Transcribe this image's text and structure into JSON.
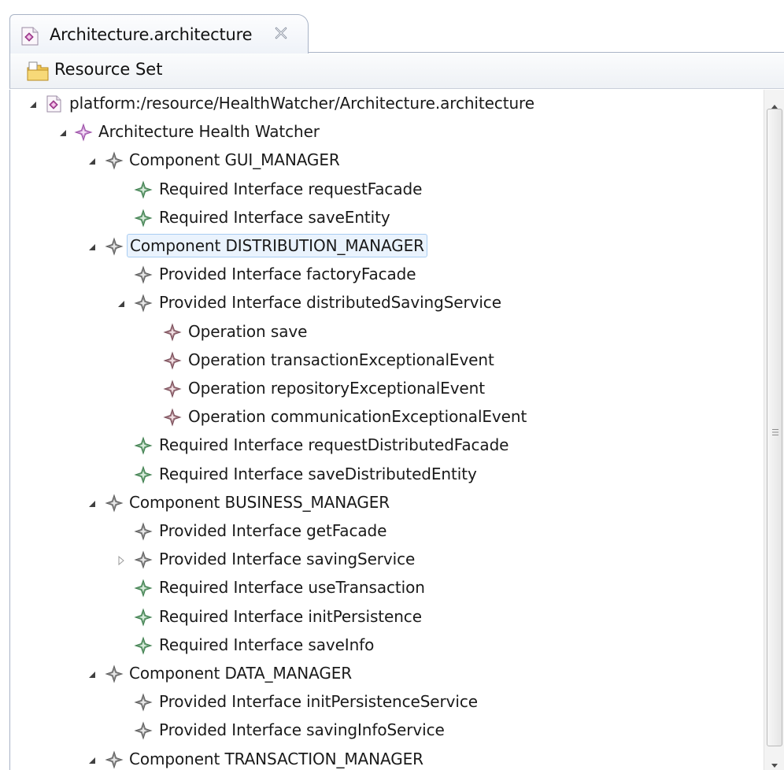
{
  "tab": {
    "title": "Architecture.architecture",
    "icon": "architecture-file-icon",
    "close_icon": "close-icon"
  },
  "resource_bar": {
    "label": "Resource Set",
    "icon": "resource-set-folder-icon"
  },
  "colors": {
    "element_purple": "#8a5a9a",
    "component_icon": "#7a4f5a",
    "required_green": "#3f7f4f",
    "selection_bg": "#eaf3fd",
    "selection_border": "#a9cdf2",
    "tab_border": "#a8b3c6"
  },
  "tree": {
    "rows": [
      {
        "label": "platform:/resource/HealthWatcher/Architecture.architecture",
        "depth": 0,
        "twisty": "expanded",
        "icon": "resource-file-icon",
        "kind": "resource"
      },
      {
        "label": "Architecture Health Watcher",
        "depth": 1,
        "twisty": "expanded",
        "icon": "architecture-diamond-icon",
        "kind": "architecture"
      },
      {
        "label": "Component GUI_MANAGER",
        "depth": 2,
        "twisty": "expanded",
        "icon": "component-diamond-icon",
        "kind": "component"
      },
      {
        "label": "Required Interface requestFacade",
        "depth": 3,
        "twisty": "none",
        "icon": "required-interface-icon",
        "kind": "required"
      },
      {
        "label": "Required Interface saveEntity",
        "depth": 3,
        "twisty": "none",
        "icon": "required-interface-icon",
        "kind": "required"
      },
      {
        "label": "Component DISTRIBUTION_MANAGER",
        "depth": 2,
        "twisty": "expanded",
        "icon": "component-diamond-icon",
        "kind": "component",
        "selected": true
      },
      {
        "label": "Provided Interface factoryFacade",
        "depth": 3,
        "twisty": "none",
        "icon": "provided-interface-icon",
        "kind": "provided"
      },
      {
        "label": "Provided Interface distributedSavingService",
        "depth": 3,
        "twisty": "expanded",
        "icon": "provided-interface-icon",
        "kind": "provided"
      },
      {
        "label": "Operation save",
        "depth": 4,
        "twisty": "none",
        "icon": "operation-icon",
        "kind": "operation"
      },
      {
        "label": "Operation transactionExceptionalEvent",
        "depth": 4,
        "twisty": "none",
        "icon": "operation-icon",
        "kind": "operation"
      },
      {
        "label": "Operation repositoryExceptionalEvent",
        "depth": 4,
        "twisty": "none",
        "icon": "operation-icon",
        "kind": "operation"
      },
      {
        "label": "Operation communicationExceptionalEvent",
        "depth": 4,
        "twisty": "none",
        "icon": "operation-icon",
        "kind": "operation"
      },
      {
        "label": "Required Interface requestDistributedFacade",
        "depth": 3,
        "twisty": "none",
        "icon": "required-interface-icon",
        "kind": "required"
      },
      {
        "label": "Required Interface saveDistributedEntity",
        "depth": 3,
        "twisty": "none",
        "icon": "required-interface-icon",
        "kind": "required"
      },
      {
        "label": "Component BUSINESS_MANAGER",
        "depth": 2,
        "twisty": "expanded",
        "icon": "component-diamond-icon",
        "kind": "component"
      },
      {
        "label": "Provided Interface getFacade",
        "depth": 3,
        "twisty": "none",
        "icon": "provided-interface-icon",
        "kind": "provided"
      },
      {
        "label": "Provided Interface savingService",
        "depth": 3,
        "twisty": "collapsed",
        "icon": "provided-interface-icon",
        "kind": "provided"
      },
      {
        "label": "Required Interface useTransaction",
        "depth": 3,
        "twisty": "none",
        "icon": "required-interface-icon",
        "kind": "required"
      },
      {
        "label": "Required Interface initPersistence",
        "depth": 3,
        "twisty": "none",
        "icon": "required-interface-icon",
        "kind": "required"
      },
      {
        "label": "Required Interface saveInfo",
        "depth": 3,
        "twisty": "none",
        "icon": "required-interface-icon",
        "kind": "required"
      },
      {
        "label": "Component DATA_MANAGER",
        "depth": 2,
        "twisty": "expanded",
        "icon": "component-diamond-icon",
        "kind": "component"
      },
      {
        "label": "Provided Interface initPersistenceService",
        "depth": 3,
        "twisty": "none",
        "icon": "provided-interface-icon",
        "kind": "provided"
      },
      {
        "label": "Provided Interface savingInfoService",
        "depth": 3,
        "twisty": "none",
        "icon": "provided-interface-icon",
        "kind": "provided"
      },
      {
        "label": "Component TRANSACTION_MANAGER",
        "depth": 2,
        "twisty": "expanded",
        "icon": "component-diamond-icon",
        "kind": "component"
      }
    ]
  },
  "scrollbar": {
    "up_icon": "scroll-up-arrow-icon",
    "down_icon": "scroll-down-arrow-icon",
    "grip_icon": "scroll-grip-icon"
  }
}
